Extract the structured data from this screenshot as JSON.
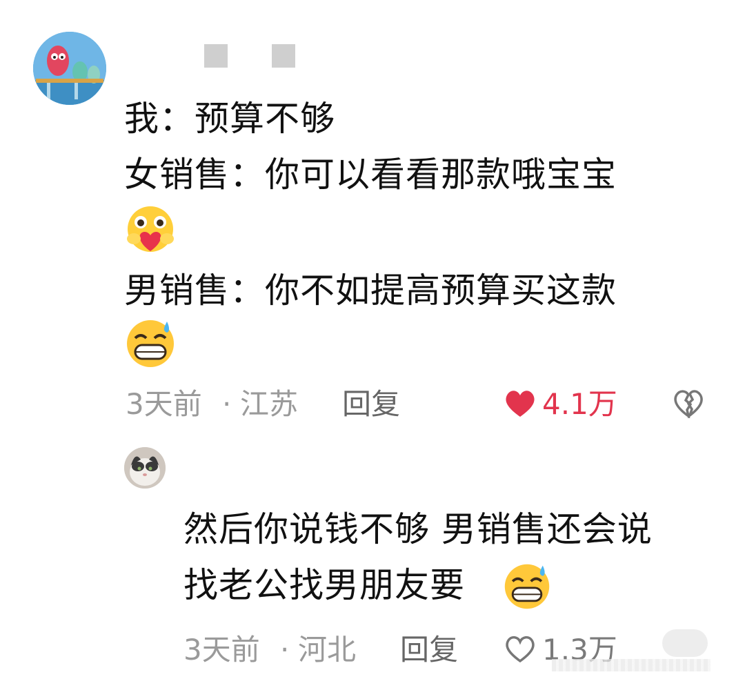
{
  "comment": {
    "lines": [
      "我：预算不够",
      "女销售：你可以看看那款哦宝宝",
      "男销售：你不如提高预算买这款"
    ],
    "emoji_1": "hug-heart-emoji",
    "emoji_2": "sweat-grin-emoji",
    "time": "3天前",
    "separator": "·",
    "location": "江苏",
    "reply_label": "回复",
    "likes": "4.1万",
    "like_color": "#e2344d"
  },
  "reply": {
    "lines": [
      "然后你说钱不够 男销售还会说",
      "找老公找男朋友要"
    ],
    "emoji": "sweat-grin-emoji",
    "time": "3天前",
    "separator": "·",
    "location": "河北",
    "reply_label": "回复",
    "likes": "1.3万"
  }
}
